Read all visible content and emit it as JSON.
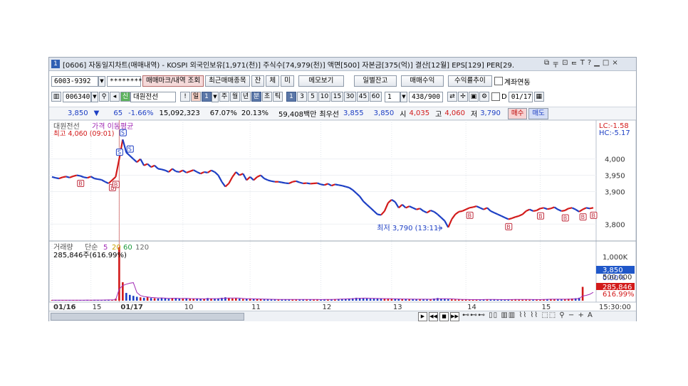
{
  "window": {
    "id_badge": "1",
    "title": "[0606] 자동일지차트(매매내역) - KOSPI 외국인보유[1,971(천)] 주식수[74,979(천)] 액면[500] 자본금[375(억)] 결산[12월] EPS[129] PER[29.",
    "icons": [
      "⧉",
      "〒",
      "⊡",
      "ᄐ",
      "T",
      "?",
      "▁",
      "□",
      "×"
    ]
  },
  "toolbar1": {
    "account": "6003-9392",
    "password": "********",
    "btn_trade_mark": "매매마크/내역 조회",
    "btn_recent": "최근매매종목",
    "btn_jan": "잔",
    "btn_che": "체",
    "btn_mi": "미",
    "btn_memo": "메모보기",
    "btn_daily_balance": "일별잔고",
    "btn_trade_profit": "매매수익",
    "btn_profit_trend": "수익률추이",
    "link_label": "계좌연동"
  },
  "toolbar2": {
    "code": "006340",
    "stock_name": "대원전선",
    "exclaim": "!",
    "period_day": "일",
    "period_num": "1",
    "periods": [
      "주",
      "월",
      "년",
      "분",
      "초",
      "틱"
    ],
    "interval_selected": "1",
    "intervals": [
      "3",
      "5",
      "10",
      "15",
      "30",
      "45",
      "60"
    ],
    "multiplier": "1",
    "count": "438/900",
    "date_label": "D",
    "date": "01/17"
  },
  "quote": {
    "price": "3,850",
    "arrow": "▼",
    "change": "65",
    "change_pct": "-1.66%",
    "volume": "15,092,323",
    "ratio1": "67.07%",
    "ratio2": "20.13%",
    "amount": "59,408백만",
    "best_label": "최우선",
    "bid1": "3,855",
    "bid2": "3,850",
    "open_label": "시",
    "open": "4,035",
    "high_label": "고",
    "high": "4,060",
    "low_label": "저",
    "low": "3,790",
    "buy": "매수",
    "sell": "매도"
  },
  "price_panel": {
    "legend_name": "대원전선",
    "legend_ma": "가격 이동평균",
    "high_note": "최고 4,060 (09:01)",
    "low_note": "최저 3,790 (13:11)",
    "lc": "LC:-1.58",
    "hc": "HC:-5.17",
    "yticks": [
      "4,000",
      "3,950",
      "3,900",
      "3,800"
    ],
    "current_price": "3,850",
    "current_pct": "0.00%"
  },
  "volume_panel": {
    "label": "거래량",
    "ma_label": "단순",
    "ma": [
      "5",
      "20",
      "60",
      "120"
    ],
    "value": "285,846주(616.99%)",
    "yticks": [
      "1,000K",
      "500,000"
    ],
    "tag_value": "285,846",
    "tag_pct": "616.99%"
  },
  "xaxis": {
    "labels": [
      "01/16",
      "15",
      "01/17",
      "10",
      "11",
      "12",
      "13",
      "14",
      "15"
    ],
    "end_time": "15:30:00"
  },
  "colors": {
    "up": "#d21a1a",
    "down": "#1d3fc4",
    "ma": "#a12ab5",
    "marker": "#c03040"
  },
  "chart_data": {
    "type": "line",
    "title": "",
    "ylim": [
      3770,
      4080
    ],
    "markers": [
      "S",
      "B"
    ],
    "series": [
      {
        "name": "대원전선",
        "values": [
          3945,
          3942,
          3940,
          3944,
          3946,
          3943,
          3947,
          3950,
          3948,
          3944,
          3942,
          3946,
          3940,
          3938,
          3936,
          3930,
          3925,
          3935,
          3945,
          4000,
          4060,
          4020,
          4010,
          4000,
          3990,
          4000,
          3980,
          3985,
          3975,
          3980,
          3970,
          3968,
          3965,
          3960,
          3970,
          3962,
          3960,
          3965,
          3958,
          3962,
          3966,
          3960,
          3955,
          3960,
          3958,
          3965,
          3960,
          3950,
          3930,
          3915,
          3925,
          3945,
          3960,
          3950,
          3955,
          3935,
          3945,
          3935,
          3945,
          3950,
          3940,
          3935,
          3932,
          3930,
          3930,
          3928,
          3926,
          3925,
          3930,
          3932,
          3928,
          3925,
          3926,
          3924,
          3925,
          3926,
          3922,
          3920,
          3924,
          3918,
          3922,
          3920,
          3918,
          3915,
          3912,
          3905,
          3895,
          3885,
          3870,
          3860,
          3850,
          3840,
          3830,
          3828,
          3840,
          3865,
          3875,
          3868,
          3850,
          3860,
          3850,
          3855,
          3850,
          3845,
          3848,
          3840,
          3835,
          3842,
          3838,
          3830,
          3820,
          3810,
          3790,
          3815,
          3830,
          3838,
          3840,
          3845,
          3850,
          3852,
          3855,
          3850,
          3845,
          3850,
          3840,
          3835,
          3830,
          3825,
          3820,
          3815,
          3818,
          3822,
          3825,
          3830,
          3840,
          3845,
          3840,
          3842,
          3848,
          3850,
          3846,
          3848,
          3852,
          3845,
          3840,
          3842,
          3848,
          3850,
          3845,
          3838,
          3845,
          3850,
          3848,
          3850
        ]
      },
      {
        "name": "거래량",
        "values": [
          12,
          10,
          14,
          11,
          13,
          9,
          12,
          15,
          10,
          12,
          14,
          11,
          16,
          13,
          12,
          18,
          20,
          15,
          40,
          1100,
          380,
          160,
          120,
          100,
          80,
          70,
          60,
          75,
          55,
          50,
          45,
          60,
          50,
          40,
          55,
          48,
          42,
          45,
          50,
          38,
          36,
          40,
          35,
          42,
          55,
          40,
          38,
          45,
          60,
          70,
          55,
          45,
          50,
          40,
          35,
          38,
          42,
          36,
          30,
          32,
          28,
          30,
          26,
          25,
          24,
          28,
          26,
          22,
          24,
          26,
          28,
          24,
          22,
          25,
          27,
          23,
          22,
          26,
          28,
          30,
          32,
          35,
          38,
          40,
          45,
          50,
          60,
          55,
          50,
          45,
          40,
          50,
          45,
          42,
          38,
          35,
          40,
          36,
          34,
          32,
          30,
          28,
          35,
          32,
          30,
          28,
          26,
          30,
          45,
          55,
          40,
          35,
          30,
          28,
          26,
          25,
          24,
          22,
          20,
          22,
          24,
          25,
          26,
          28,
          24,
          22,
          20,
          22,
          24,
          26,
          28,
          30,
          26,
          24,
          22,
          20,
          24,
          26,
          28,
          30,
          32,
          35,
          30,
          28,
          26,
          32,
          40,
          45,
          50,
          60,
          285
        ]
      }
    ]
  }
}
